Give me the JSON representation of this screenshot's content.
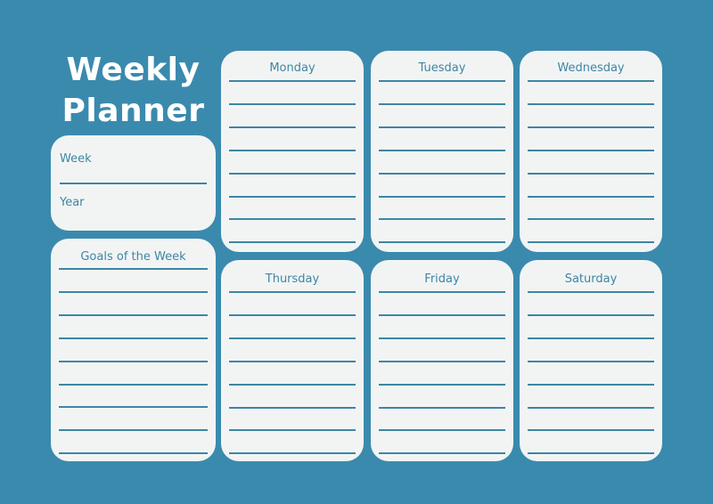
{
  "title": {
    "line1": "Weekly",
    "line2": "Planner"
  },
  "info_card": {
    "week_label": "Week",
    "year_label": "Year"
  },
  "goals_card": {
    "heading": "Goals of the Week",
    "line_count": 9
  },
  "days": [
    {
      "name": "Monday",
      "line_count": 8
    },
    {
      "name": "Tuesday",
      "line_count": 8
    },
    {
      "name": "Wednesday",
      "line_count": 8
    },
    {
      "name": "Thursday",
      "line_count": 8
    },
    {
      "name": "Friday",
      "line_count": 8
    },
    {
      "name": "Saturday",
      "line_count": 8
    }
  ],
  "colors": {
    "background": "#3a8aae",
    "card": "#f2f4f4",
    "accent": "#3d86a4"
  }
}
